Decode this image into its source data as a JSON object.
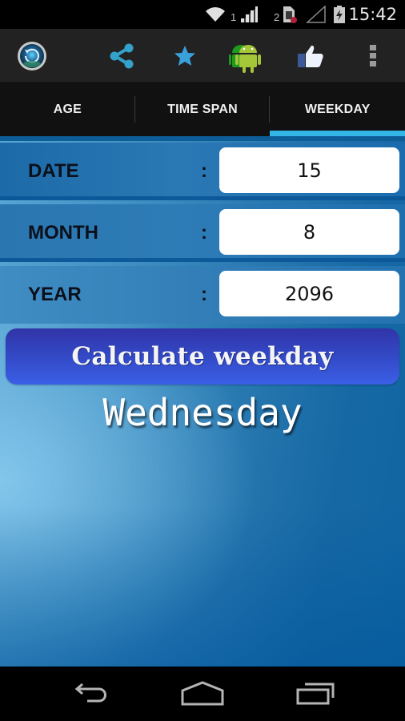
{
  "status_bar": {
    "wifi_icon": "wifi-icon",
    "sim1_label": "1",
    "sim1_signal_icon": "signal-icon",
    "sim2_label": "2",
    "sim2_icon": "sim-card-blocked-icon",
    "sim2_signal_icon": "signal-empty-icon",
    "battery_icon": "battery-charging-icon",
    "time": "15:42"
  },
  "action_bar": {
    "app_icon": "app-logo-icon",
    "actions": [
      {
        "name": "share",
        "icon": "share-icon",
        "color": "#33a1c9"
      },
      {
        "name": "favorite",
        "icon": "star-icon",
        "color": "#3aa0dc"
      },
      {
        "name": "more-apps",
        "icon": "android-icon",
        "color": "#9fc33b"
      },
      {
        "name": "like",
        "icon": "thumbs-up-icon",
        "color": "#3b5998"
      },
      {
        "name": "overflow",
        "icon": "overflow-menu-icon",
        "color": "#9a9a9a"
      }
    ]
  },
  "tabs": [
    {
      "label": "AGE",
      "active": false
    },
    {
      "label": "TIME SPAN",
      "active": false
    },
    {
      "label": "WEEKDAY",
      "active": true
    }
  ],
  "accent_color": "#33b5e5",
  "form": {
    "separator": ":",
    "fields": [
      {
        "label": "DATE",
        "value": "15"
      },
      {
        "label": "MONTH",
        "value": "8"
      },
      {
        "label": "YEAR",
        "value": "2096"
      }
    ]
  },
  "calculate_button": {
    "label": "Calculate weekday"
  },
  "result": {
    "text": "Wednesday"
  },
  "nav_bar": {
    "back_icon": "back-icon",
    "home_icon": "home-icon",
    "recents_icon": "recents-icon"
  }
}
